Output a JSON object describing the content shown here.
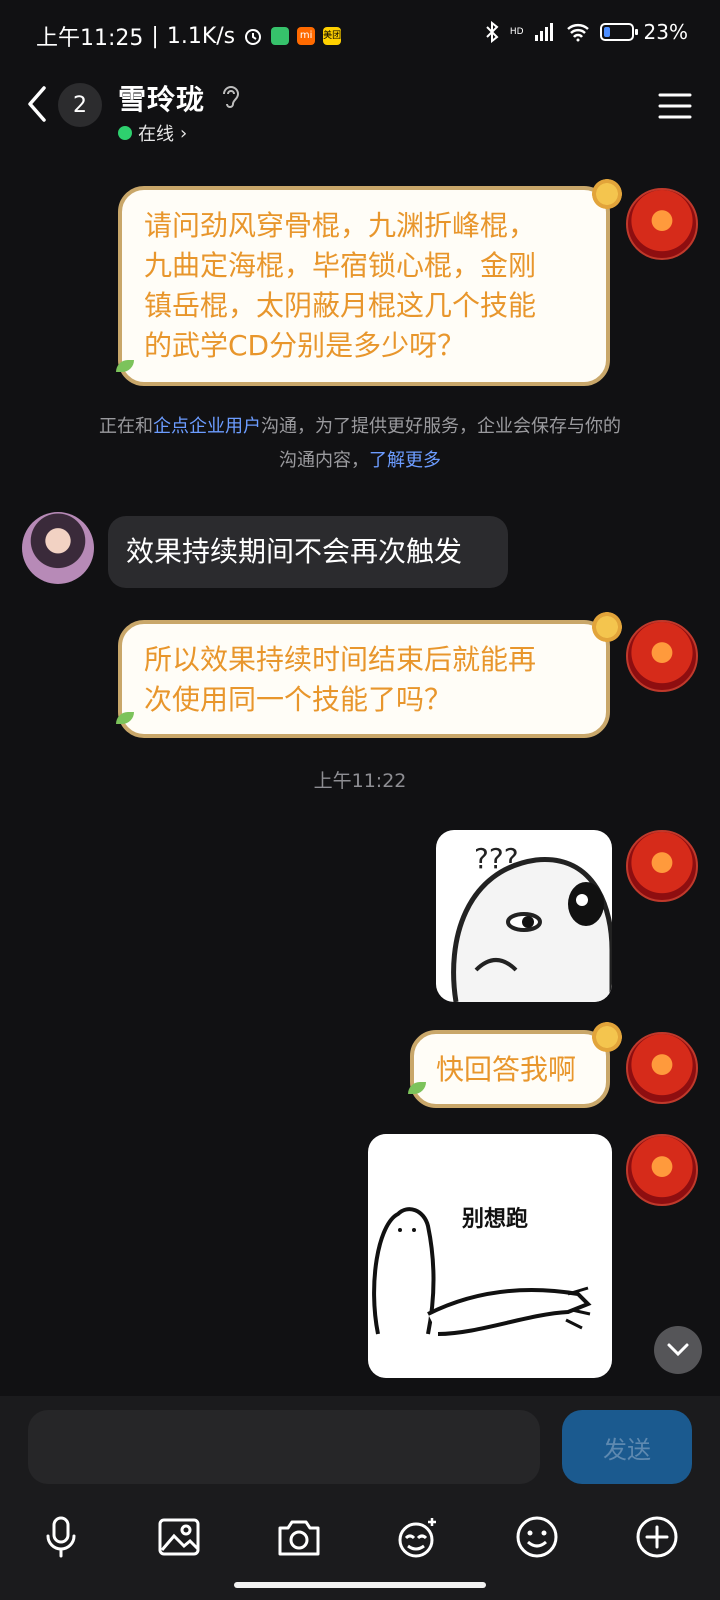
{
  "status_bar": {
    "time": "上午11:25",
    "net_speed": "1.1K/s",
    "app_mi": "mi",
    "app_meituan": "美团",
    "signal_label": "HD",
    "battery": "23%",
    "battery_level": 0.23
  },
  "header": {
    "back_count": "2",
    "title": "雪玲珑",
    "status": "在线",
    "status_color": "#2ed06e"
  },
  "messages": {
    "m1": [
      "请问劲风穿骨棍，九渊折峰棍，",
      "九曲定海棍，毕宿锁心棍，金刚",
      "镇岳棍，太阴蔽月棍这几个技能",
      "的武学CD分别是多少呀？"
    ],
    "notice_pre": "正在和",
    "notice_link1": "企点企业用户",
    "notice_mid": "沟通，为了提供更好服务，企业会保存与你的",
    "notice_line2": "沟通内容，",
    "notice_link2": "了解更多",
    "m2": "效果持续期间不会再次触发",
    "m3": [
      "所以效果持续时间结束后就能再",
      "次使用同一个技能了吗？"
    ],
    "timestamp": "上午11:22",
    "sticker1_text": "???",
    "m4": "快回答我啊",
    "sticker2_text": "别想跑"
  },
  "input_bar": {
    "placeholder": "",
    "send_label": "发送"
  },
  "colors": {
    "bubble_text": "#e8962c",
    "bubble_border": "#c9a76a",
    "link": "#6c9cff",
    "send_bg": "#1b5a8f"
  },
  "icons": [
    "back-icon",
    "ear-icon",
    "menu-icon",
    "mic-icon",
    "image-icon",
    "camera-icon",
    "sticker-icon",
    "emoji-icon",
    "plus-icon",
    "chevron-down-icon"
  ]
}
